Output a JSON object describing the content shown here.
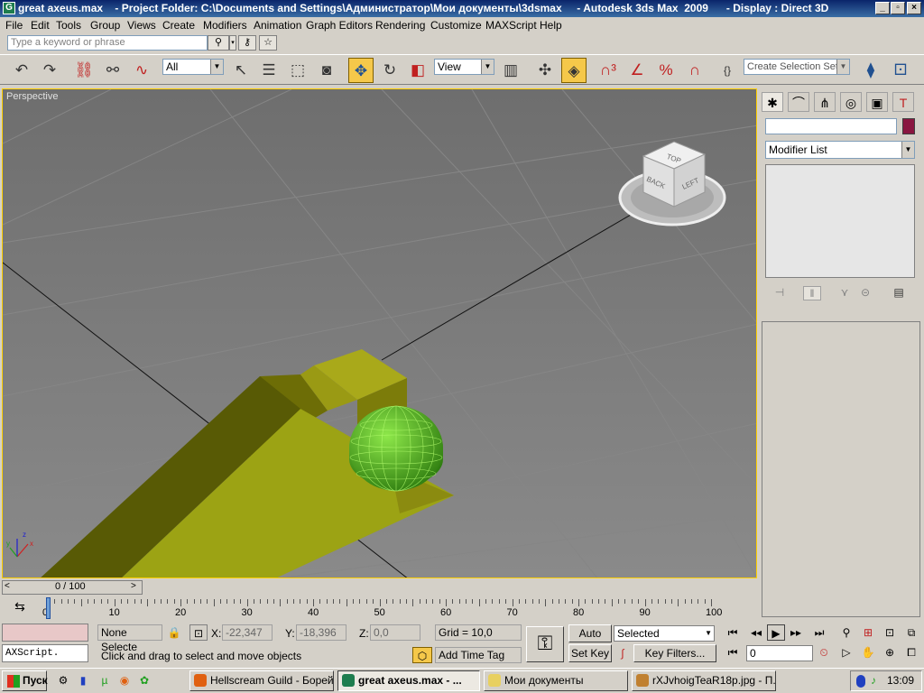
{
  "window": {
    "title": "great axeus.max    - Project Folder: C:\\Documents and Settings\\Администратор\\Мои документы\\3dsmax     - Autodesk 3ds Max  2009      - Display : Direct 3D",
    "min": "_",
    "max": "▫",
    "close": "×"
  },
  "menu": [
    "File",
    "Edit",
    "Tools",
    "Group",
    "Views",
    "Create",
    "Modifiers",
    "Animation",
    "Graph Editors",
    "Rendering",
    "Customize",
    "MAXScript",
    "Help"
  ],
  "search": {
    "placeholder": "Type a keyword or phrase"
  },
  "toolbar": {
    "filter": "All",
    "coord": "View",
    "selection_set": "Create Selection Set"
  },
  "viewport": {
    "label": "Perspective",
    "viewcube": {
      "top": "TOP",
      "back": "BACK",
      "left": "LEFT"
    }
  },
  "command_panel": {
    "modifier_list": "Modifier List"
  },
  "time_slider": {
    "value": "0 / 100"
  },
  "track_ticks": [
    "0",
    "10",
    "20",
    "30",
    "40",
    "50",
    "60",
    "70",
    "80",
    "90",
    "100"
  ],
  "status": {
    "selection": "None Selecte",
    "x_label": "X:",
    "x": "-22,347",
    "y_label": "Y:",
    "y": "-18,396",
    "z_label": "Z:",
    "z": "0,0",
    "grid": "Grid = 10,0",
    "prompt": "Click and drag to select and move objects",
    "time_tag": "Add Time Tag",
    "auto_key": "Auto Key",
    "set_key": "Set Key",
    "key_mode": "Selected",
    "key_filters": "Key Filters...",
    "frame": "0",
    "maxscript": "AXScript."
  },
  "taskbar": {
    "start": "Пуск",
    "tasks": [
      "Hellscream Guild - Борей...",
      "great axeus.max     - ...",
      "Мои документы",
      "rXJvhoigTeaR18p.jpg - П..."
    ],
    "clock": "13:09"
  },
  "colors": {
    "selection_yellow": "#ffd000",
    "object_color": "#8a1640",
    "sphere": "#4ea81a",
    "wedge": "#8a8a10"
  }
}
